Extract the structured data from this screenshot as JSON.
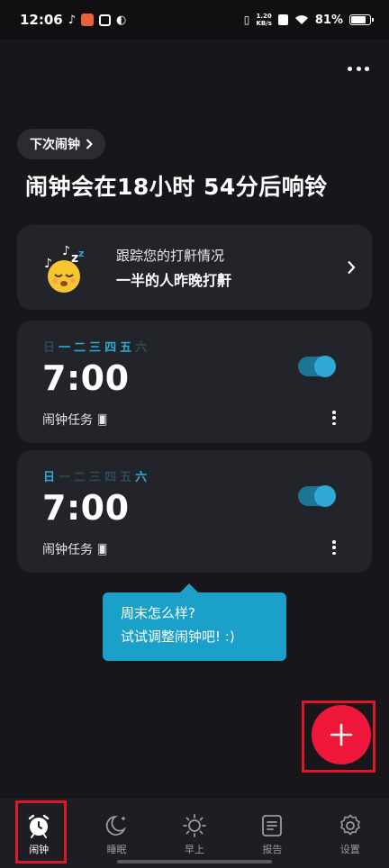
{
  "status_bar": {
    "time": "12:06",
    "net_speed_value": "1.20",
    "net_speed_unit": "KB/s",
    "battery": "81%"
  },
  "header": {
    "next_alarm_label": "下次闹钟",
    "countdown": "闹钟会在18小时 54分后响铃"
  },
  "snore_card": {
    "line1": "跟踪您的打鼾情况",
    "line2": "一半的人昨晚打鼾"
  },
  "alarms": [
    {
      "days": [
        {
          "label": "日",
          "on": false
        },
        {
          "label": "一",
          "on": true
        },
        {
          "label": "二",
          "on": true
        },
        {
          "label": "三",
          "on": true
        },
        {
          "label": "四",
          "on": true
        },
        {
          "label": "五",
          "on": true
        },
        {
          "label": "六",
          "on": false
        }
      ],
      "time": "7:00",
      "task_label": "闹钟任务",
      "enabled": true
    },
    {
      "days": [
        {
          "label": "日",
          "on": true
        },
        {
          "label": "一",
          "on": false
        },
        {
          "label": "二",
          "on": false
        },
        {
          "label": "三",
          "on": false
        },
        {
          "label": "四",
          "on": false
        },
        {
          "label": "五",
          "on": false
        },
        {
          "label": "六",
          "on": true
        }
      ],
      "time": "7:00",
      "task_label": "闹钟任务",
      "enabled": true
    }
  ],
  "tooltip": {
    "line1": "周末怎么样?",
    "line2": "试试调整闹钟吧! :)"
  },
  "nav": {
    "items": [
      {
        "label": "闹钟",
        "icon": "alarm-clock-icon",
        "active": true
      },
      {
        "label": "睡眠",
        "icon": "moon-icon",
        "active": false
      },
      {
        "label": "早上",
        "icon": "sun-icon",
        "active": false
      },
      {
        "label": "报告",
        "icon": "report-icon",
        "active": false
      },
      {
        "label": "设置",
        "icon": "gear-icon",
        "active": false
      }
    ]
  },
  "colors": {
    "accent": "#2fa9d5",
    "fab": "#f0183a",
    "highlight_frame": "#e0162b"
  }
}
